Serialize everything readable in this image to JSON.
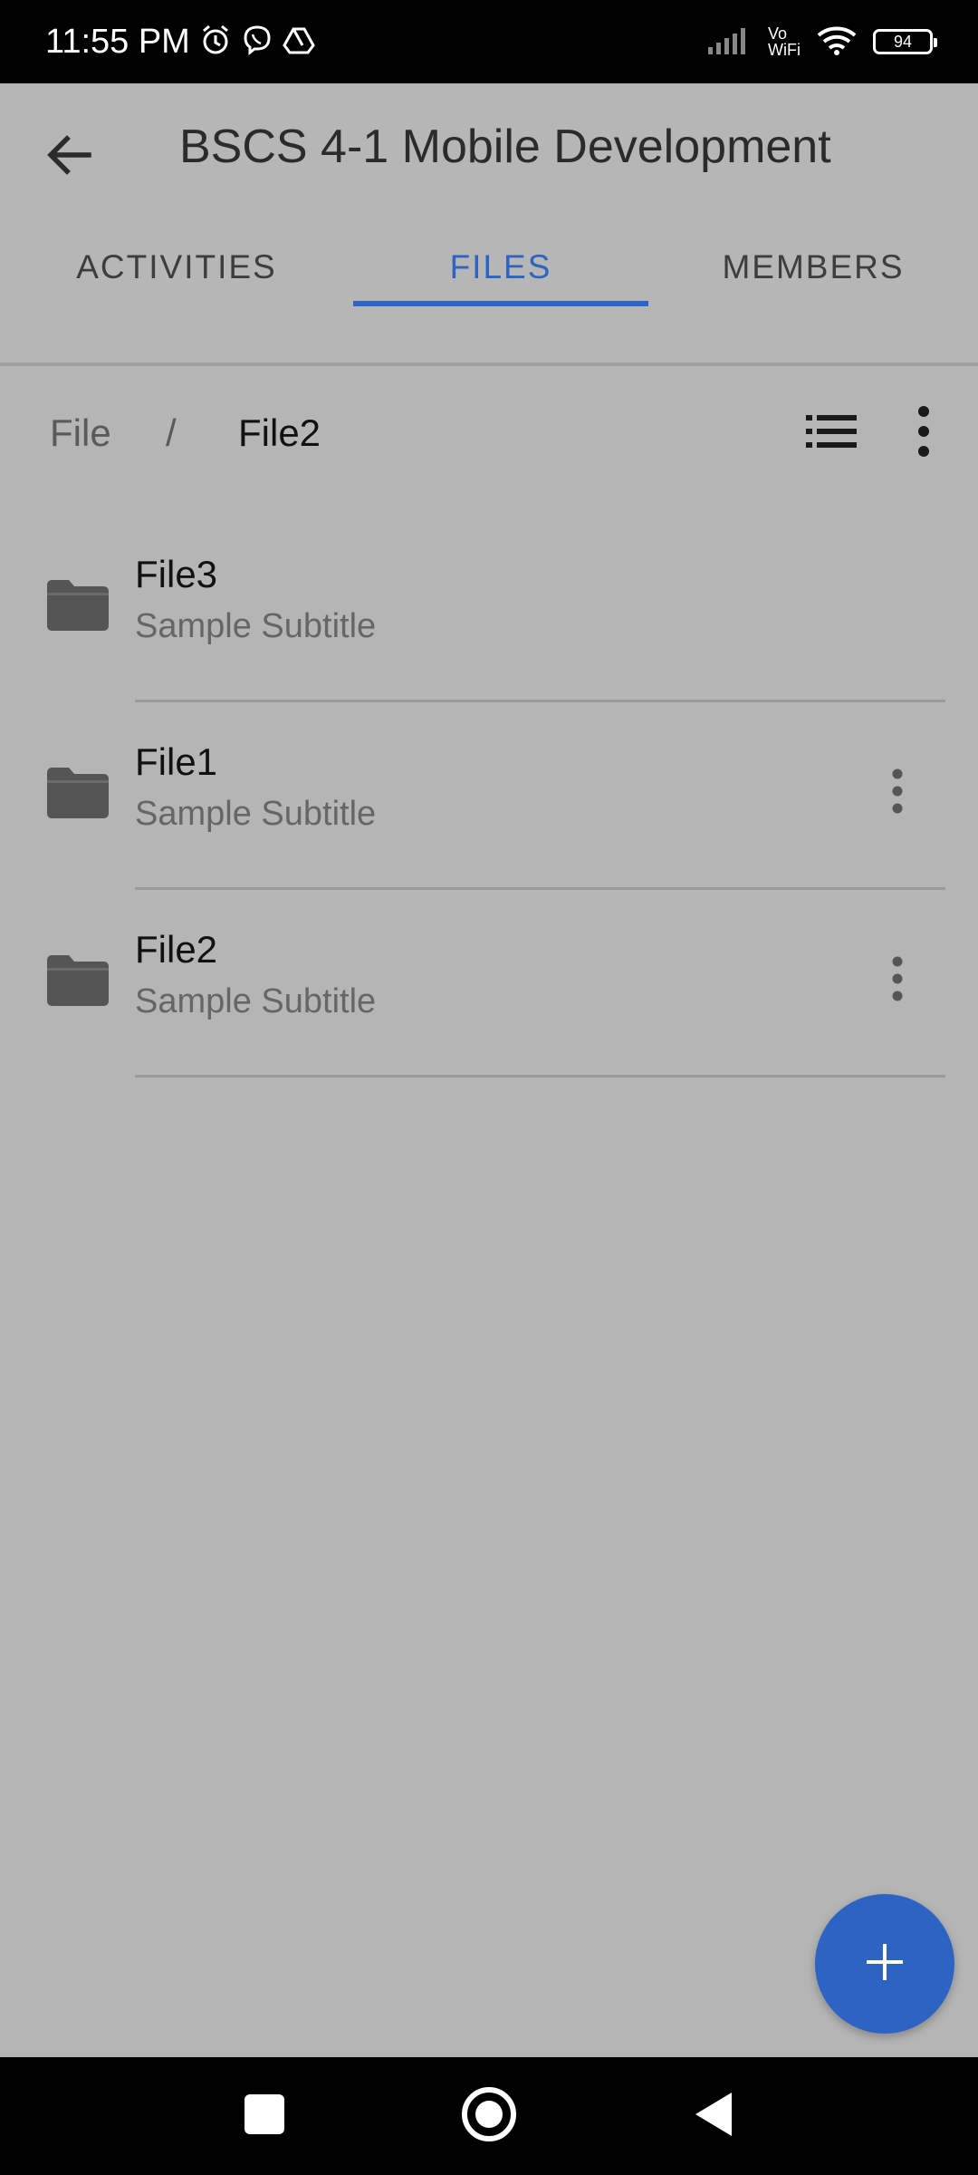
{
  "status_bar": {
    "time": "11:55 PM",
    "network_label_top": "Vo",
    "network_label_bottom": "WiFi",
    "battery": "94",
    "icons": [
      "alarm-icon",
      "viber-icon",
      "drive-icon",
      "signal-icon",
      "wifi-icon",
      "battery-icon"
    ]
  },
  "app_bar": {
    "title": "BSCS 4-1 Mobile Development",
    "back_icon": "arrow-left-icon"
  },
  "tabs": [
    {
      "label": "ACTIVITIES",
      "active": false
    },
    {
      "label": "FILES",
      "active": true
    },
    {
      "label": "MEMBERS",
      "active": false
    }
  ],
  "breadcrumb": {
    "root": "File",
    "separator": "/",
    "current": "File2"
  },
  "files": [
    {
      "name": "File3",
      "subtitle": "Sample Subtitle",
      "has_menu": false
    },
    {
      "name": "File1",
      "subtitle": "Sample Subtitle",
      "has_menu": true
    },
    {
      "name": "File2",
      "subtitle": "Sample Subtitle",
      "has_menu": true
    }
  ],
  "colors": {
    "accent": "#2d63c2",
    "background": "#b5b5b5",
    "icon": "#555555"
  }
}
